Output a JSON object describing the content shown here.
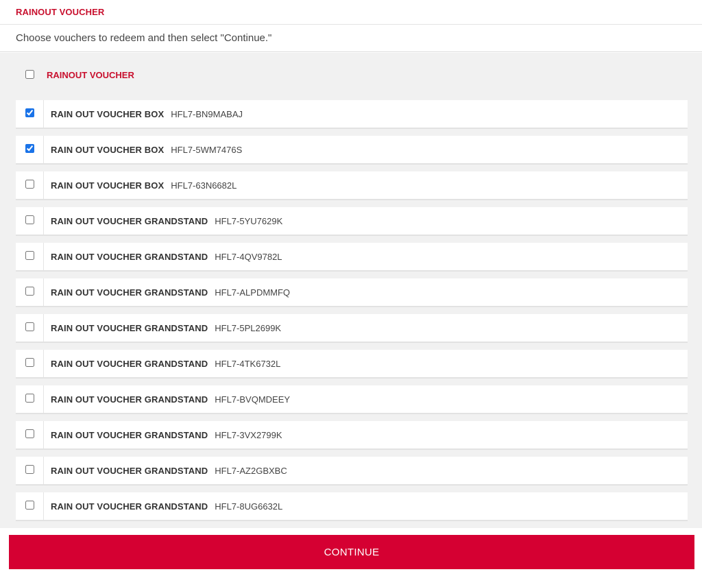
{
  "header": {
    "title": "RAINOUT VOUCHER"
  },
  "instructions": "Choose vouchers to redeem and then select \"Continue.\"",
  "group": {
    "label": "RAINOUT VOUCHER",
    "checked": false
  },
  "vouchers": [
    {
      "name": "RAIN OUT VOUCHER BOX",
      "code": "HFL7-BN9MABAJ",
      "checked": true
    },
    {
      "name": "RAIN OUT VOUCHER BOX",
      "code": "HFL7-5WM7476S",
      "checked": true
    },
    {
      "name": "RAIN OUT VOUCHER BOX",
      "code": "HFL7-63N6682L",
      "checked": false
    },
    {
      "name": "RAIN OUT VOUCHER GRANDSTAND",
      "code": "HFL7-5YU7629K",
      "checked": false
    },
    {
      "name": "RAIN OUT VOUCHER GRANDSTAND",
      "code": "HFL7-4QV9782L",
      "checked": false
    },
    {
      "name": "RAIN OUT VOUCHER GRANDSTAND",
      "code": "HFL7-ALPDMMFQ",
      "checked": false
    },
    {
      "name": "RAIN OUT VOUCHER GRANDSTAND",
      "code": "HFL7-5PL2699K",
      "checked": false
    },
    {
      "name": "RAIN OUT VOUCHER GRANDSTAND",
      "code": "HFL7-4TK6732L",
      "checked": false
    },
    {
      "name": "RAIN OUT VOUCHER GRANDSTAND",
      "code": "HFL7-BVQMDEEY",
      "checked": false
    },
    {
      "name": "RAIN OUT VOUCHER GRANDSTAND",
      "code": "HFL7-3VX2799K",
      "checked": false
    },
    {
      "name": "RAIN OUT VOUCHER GRANDSTAND",
      "code": "HFL7-AZ2GBXBC",
      "checked": false
    },
    {
      "name": "RAIN OUT VOUCHER GRANDSTAND",
      "code": "HFL7-8UG6632L",
      "checked": false
    }
  ],
  "footer": {
    "continue_label": "CONTINUE"
  },
  "colors": {
    "accent": "#c8102e",
    "button": "#d50032",
    "background": "#f1f1f1"
  }
}
